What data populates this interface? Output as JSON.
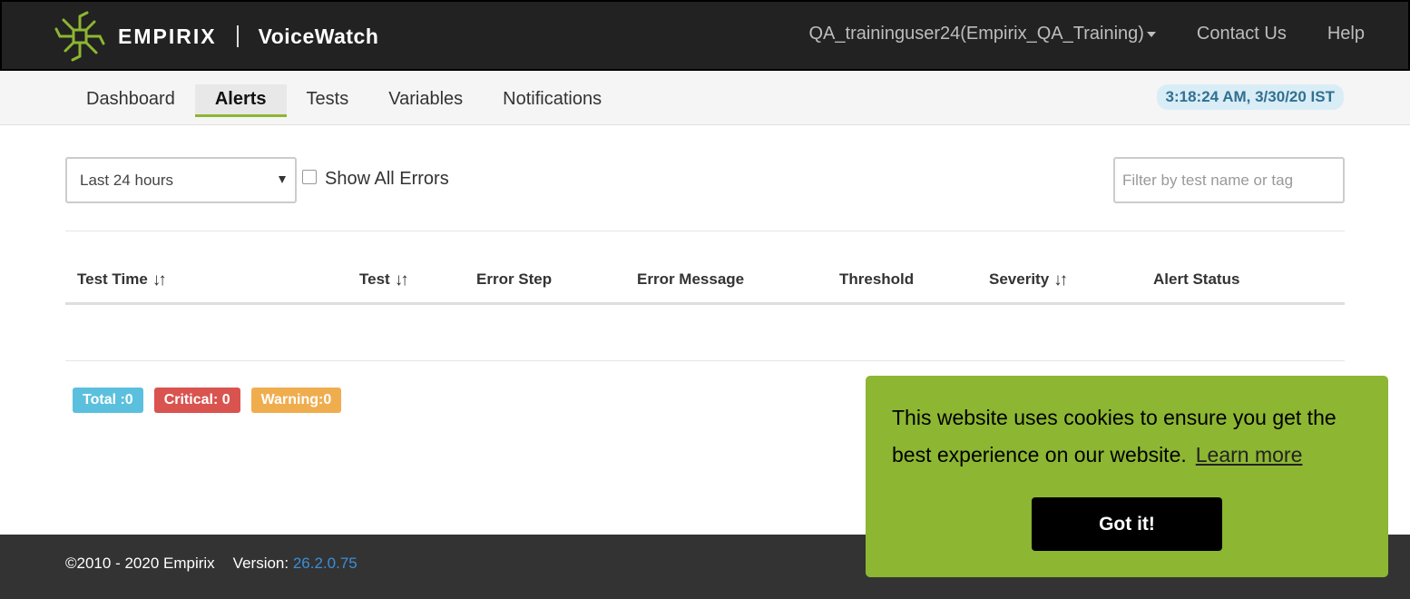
{
  "header": {
    "brand_name": "EMPIRIX",
    "product_name": "VoiceWatch",
    "user_menu_label": "QA_traininguser24(Empirix_QA_Training)",
    "contact_label": "Contact Us",
    "help_label": "Help"
  },
  "subnav": {
    "tabs": [
      {
        "label": "Dashboard"
      },
      {
        "label": "Alerts",
        "active": true
      },
      {
        "label": "Tests"
      },
      {
        "label": "Variables"
      },
      {
        "label": "Notifications"
      }
    ],
    "clock": "3:18:24 AM, 3/30/20 IST"
  },
  "filters": {
    "time_range_selected": "Last 24 hours",
    "show_all_errors_label": "Show All Errors",
    "show_all_errors_checked": false,
    "search_placeholder": "Filter by test name or tag"
  },
  "table": {
    "columns": [
      "Test Time",
      "Test",
      "Error Step",
      "Error Message",
      "Threshold",
      "Severity",
      "Alert Status"
    ],
    "rows": []
  },
  "badges": {
    "total": "Total :0",
    "critical": "Critical: 0",
    "warning": "Warning:0"
  },
  "footer": {
    "copyright": "©2010 - 2020 Empirix",
    "version_label": "Version:",
    "version_value": "26.2.0.75"
  },
  "cookie_banner": {
    "message": "This website uses cookies to ensure you get the best experience on our website.",
    "link_label": "Learn more",
    "button_label": "Got it!"
  },
  "colors": {
    "accent": "#8db632",
    "header_bg": "#222222",
    "total_badge": "#5bc0de",
    "critical_badge": "#d9534f",
    "warning_badge": "#f0ad4e",
    "version_link": "#3c8ed8"
  },
  "icons": {
    "logo": "empirix-circuit-logo",
    "sort": "sort-arrows-icon",
    "user_menu_caret": "caret-down-icon",
    "select_arrow": "triangle-down-icon"
  }
}
